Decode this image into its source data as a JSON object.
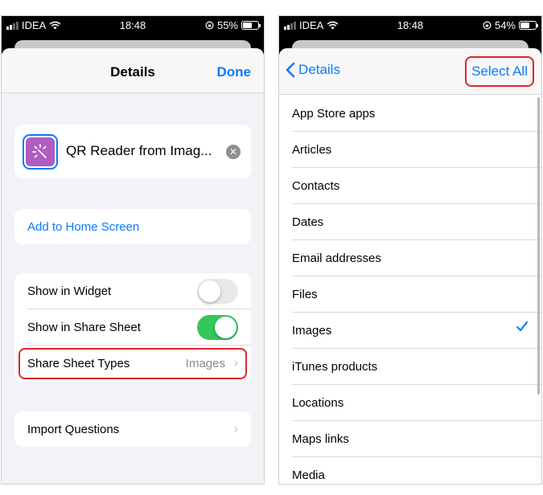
{
  "left_phone": {
    "status": {
      "carrier": "IDEA",
      "time": "18:48",
      "battery": "55%",
      "battery_level": 0.55
    },
    "nav": {
      "title": "Details",
      "done_label": "Done"
    },
    "shortcut": {
      "name": "QR Reader from Imag...",
      "icon": "wand-sparkle-icon",
      "icon_color": "#b05cc2"
    },
    "home": {
      "label": "Add to Home Screen"
    },
    "toggles": [
      {
        "label": "Show in Widget",
        "on": false
      },
      {
        "label": "Show in Share Sheet",
        "on": true
      }
    ],
    "share_types": {
      "label": "Share Sheet Types",
      "value": "Images"
    },
    "import": {
      "label": "Import Questions"
    }
  },
  "right_phone": {
    "status": {
      "carrier": "IDEA",
      "time": "18:48",
      "battery": "54%",
      "battery_level": 0.54
    },
    "nav": {
      "back_label": "Details",
      "select_all_label": "Select All"
    },
    "items": [
      {
        "label": "App Store apps",
        "checked": false
      },
      {
        "label": "Articles",
        "checked": false
      },
      {
        "label": "Contacts",
        "checked": false
      },
      {
        "label": "Dates",
        "checked": false
      },
      {
        "label": "Email addresses",
        "checked": false
      },
      {
        "label": "Files",
        "checked": false
      },
      {
        "label": "Images",
        "checked": true
      },
      {
        "label": "iTunes products",
        "checked": false
      },
      {
        "label": "Locations",
        "checked": false
      },
      {
        "label": "Maps links",
        "checked": false
      },
      {
        "label": "Media",
        "checked": false
      }
    ]
  },
  "colors": {
    "accent": "#0a7aff",
    "highlight": "#e0242c",
    "switch_on": "#34c759",
    "background": "#f2f2f7"
  }
}
